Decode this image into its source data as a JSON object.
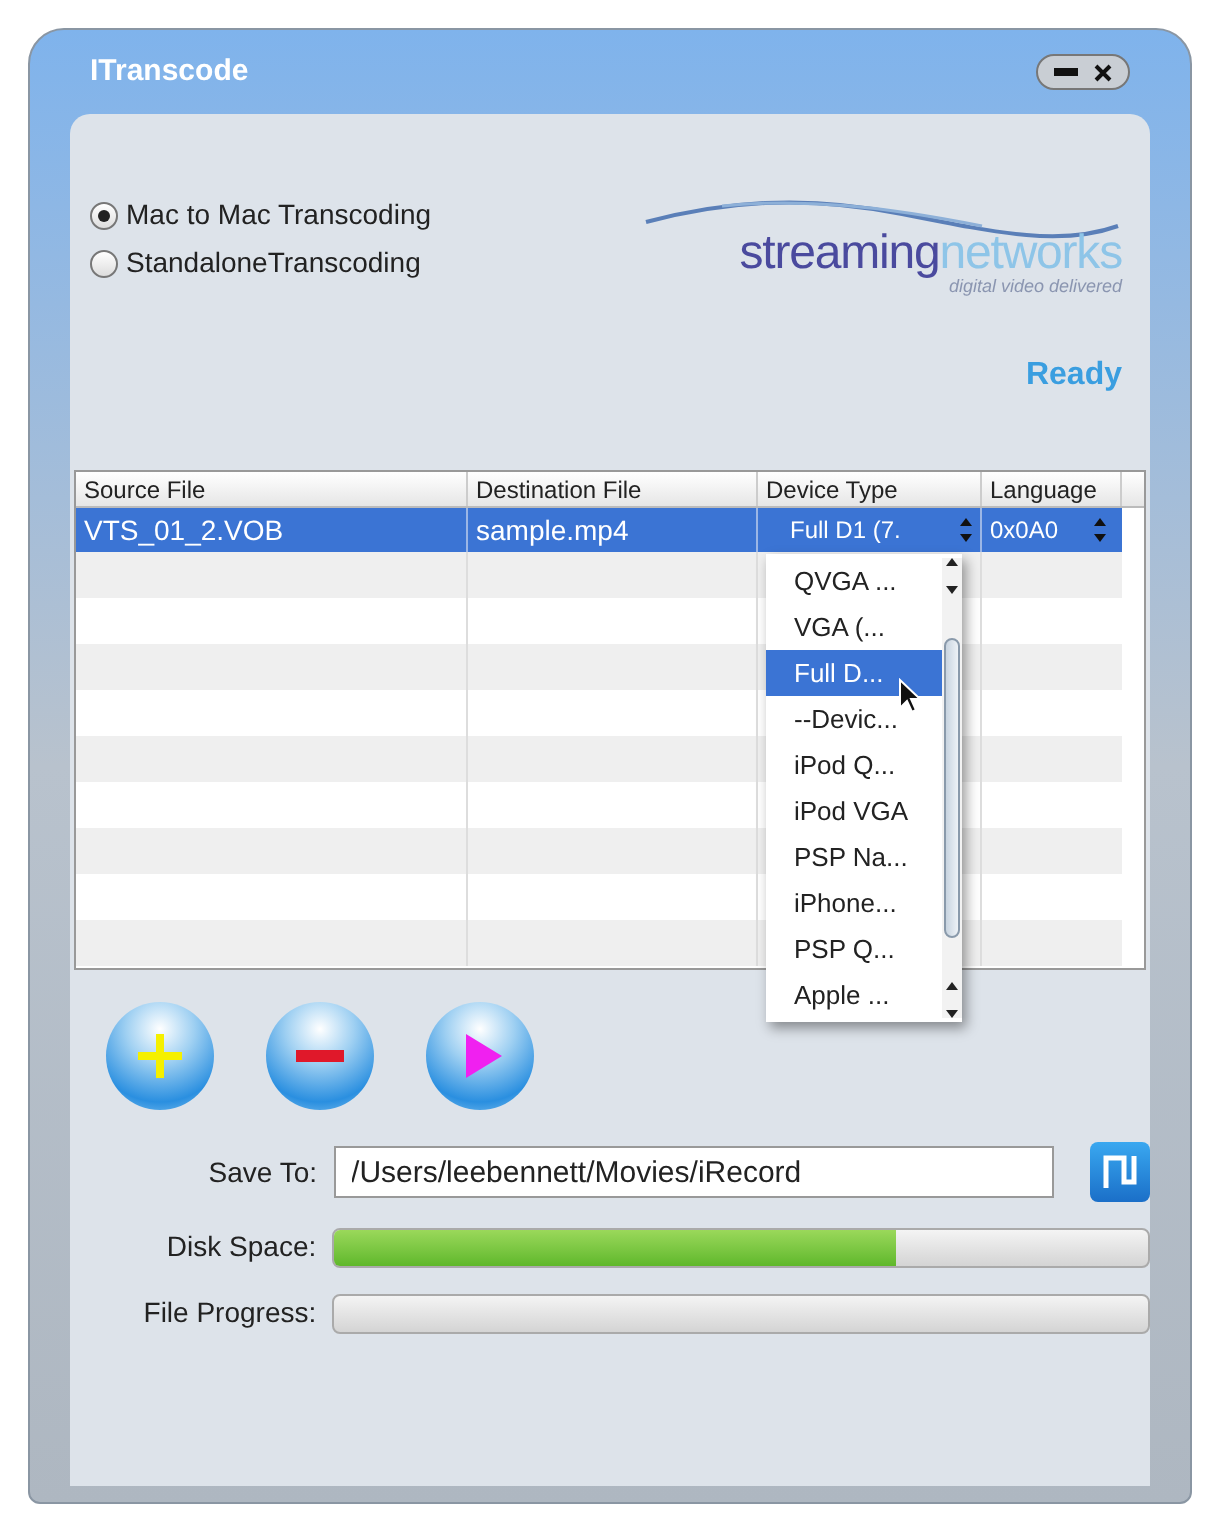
{
  "window": {
    "title": "ITranscode"
  },
  "modes": [
    {
      "label": "Mac to Mac Transcoding",
      "selected": true
    },
    {
      "label": "StandaloneTranscoding",
      "selected": false
    }
  ],
  "logo": {
    "word_1": "streaming",
    "word_2": "networks",
    "tagline": "digital video delivered"
  },
  "status": "Ready",
  "table": {
    "columns": [
      "Source File",
      "Destination File",
      "Device Type",
      "Language"
    ],
    "rows": [
      {
        "source": "VTS_01_2.VOB",
        "destination": "sample.mp4",
        "device": "Full D1 (7.",
        "language": "0x0A0",
        "selected": true
      }
    ]
  },
  "device_menu": {
    "items": [
      {
        "label": "QVGA ...",
        "selected": false
      },
      {
        "label": "VGA (...",
        "selected": false
      },
      {
        "label": "Full D...",
        "selected": true
      },
      {
        "label": "--Devic...",
        "selected": false
      },
      {
        "label": "iPod Q...",
        "selected": false
      },
      {
        "label": "iPod VGA",
        "selected": false
      },
      {
        "label": "PSP Na...",
        "selected": false
      },
      {
        "label": "iPhone...",
        "selected": false
      },
      {
        "label": "PSP Q...",
        "selected": false
      },
      {
        "label": "Apple ...",
        "selected": false
      }
    ]
  },
  "save_to": {
    "label": "Save To:",
    "value": "/Users/leebennett/Movies/iRecord"
  },
  "disk_space": {
    "label": "Disk Space:",
    "level": 0.69
  },
  "file_progress": {
    "label": "File Progress:",
    "level": 0
  }
}
